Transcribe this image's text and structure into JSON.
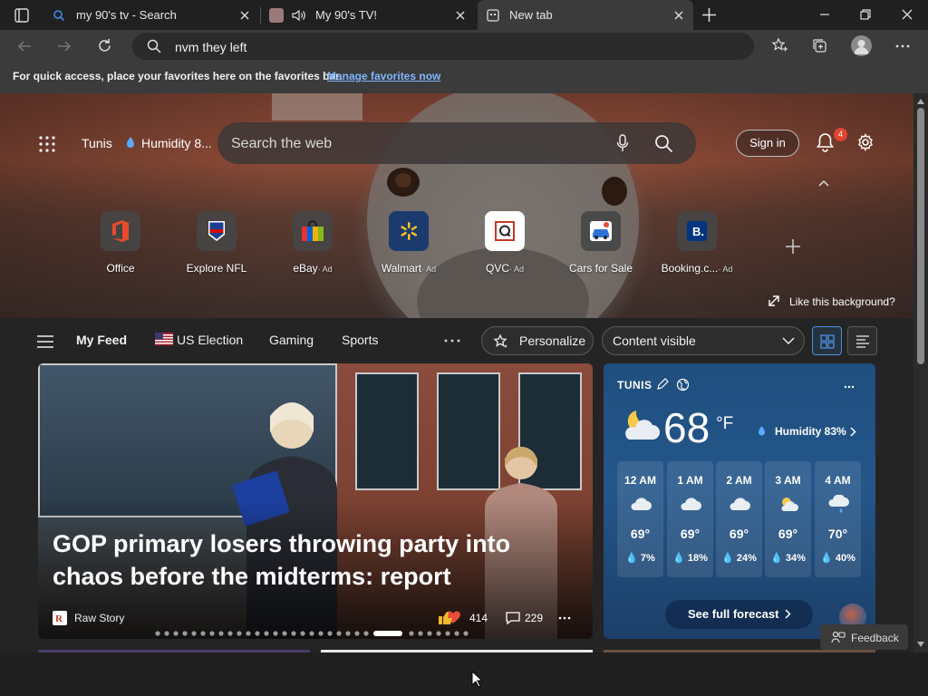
{
  "tabs": [
    {
      "title": "my 90's tv - Search",
      "favicon": "search-favicon"
    },
    {
      "title": "My 90's TV!",
      "favicon": "page-favicon",
      "audio": "speaker-icon"
    },
    {
      "title": "New tab",
      "favicon": "newtab-favicon",
      "active": true
    }
  ],
  "address": {
    "value": "nvm they left"
  },
  "favbar": {
    "message": "For quick access, place your favorites here on the favorites bar.",
    "link": "Manage favorites now"
  },
  "header": {
    "location": "Tunis",
    "humidity": "Humidity 8...",
    "search_placeholder": "Search the web",
    "signin": "Sign in",
    "notif_count": "4"
  },
  "quick_links": [
    {
      "label": "Office",
      "ad": ""
    },
    {
      "label": "Explore NFL",
      "ad": ""
    },
    {
      "label": "eBay",
      "ad": "· Ad"
    },
    {
      "label": "Walmart",
      "ad": "· Ad"
    },
    {
      "label": "QVC",
      "ad": "· Ad"
    },
    {
      "label": "Cars for Sale",
      "ad": ""
    },
    {
      "label": "Booking.c...",
      "ad": "· Ad"
    }
  ],
  "background": {
    "like": "Like this background?"
  },
  "feed": {
    "tabs": [
      "My Feed",
      "US Election",
      "Gaming",
      "Sports"
    ],
    "personalize": "Personalize",
    "content_visible": "Content visible"
  },
  "story": {
    "title": "GOP primary losers throwing party into chaos before the midterms: report",
    "source": "Raw Story",
    "reactions": "414",
    "comments": "229"
  },
  "weather": {
    "city": "TUNIS",
    "temp": "68",
    "unit": "°F",
    "humidity": "Humidity 83%",
    "hours": [
      {
        "time": "12 AM",
        "temp": "69°",
        "precip": "7%",
        "icon": "cloud-icon"
      },
      {
        "time": "1 AM",
        "temp": "69°",
        "precip": "18%",
        "icon": "cloud-icon"
      },
      {
        "time": "2 AM",
        "temp": "69°",
        "precip": "24%",
        "icon": "cloud-icon"
      },
      {
        "time": "3 AM",
        "temp": "69°",
        "precip": "34%",
        "icon": "partly-cloudy-icon"
      },
      {
        "time": "4 AM",
        "temp": "70°",
        "precip": "40%",
        "icon": "rain-cloud-icon"
      }
    ],
    "forecast": "See full forecast"
  },
  "feedback": "Feedback"
}
